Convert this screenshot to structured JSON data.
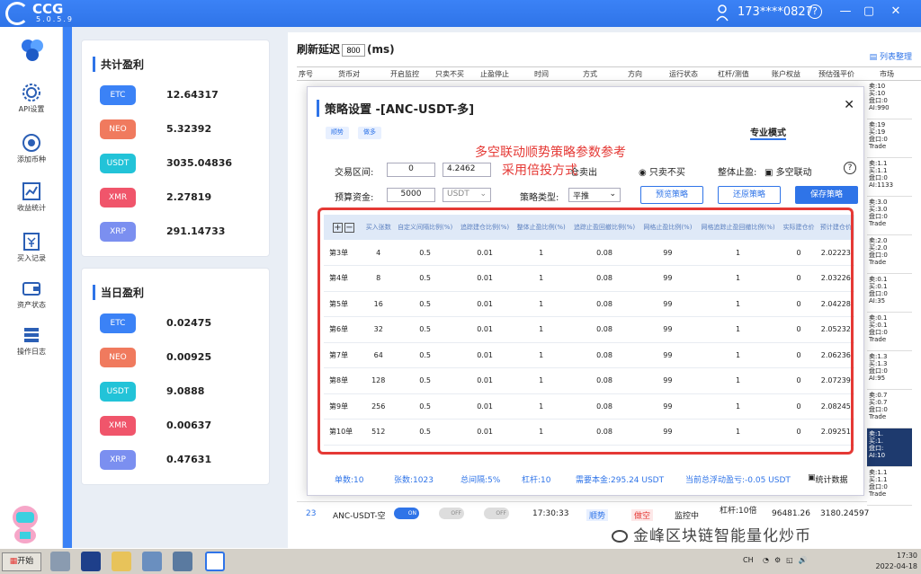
{
  "app": {
    "name": "CCG",
    "version": "5.0.5.9",
    "user": "173****0827",
    "controls": {
      "help": "?",
      "minimize": "—",
      "maximize": "▢",
      "close": "✕"
    }
  },
  "sidebar": {
    "items": [
      {
        "label": "API设置"
      },
      {
        "label": "添加币种"
      },
      {
        "label": "收益统计"
      },
      {
        "label": "买入记录"
      },
      {
        "label": "资产状态"
      },
      {
        "label": "操作日志"
      }
    ]
  },
  "total_profit": {
    "title": "共计盈利",
    "rows": [
      {
        "coin": "ETC",
        "value": "12.64317",
        "color": "#3b82f6"
      },
      {
        "coin": "NEO",
        "value": "5.32392",
        "color": "#f07a5e"
      },
      {
        "coin": "USDT",
        "value": "3035.04836",
        "color": "#22c3d8"
      },
      {
        "coin": "XMR",
        "value": "2.27819",
        "color": "#f0556b"
      },
      {
        "coin": "XRP",
        "value": "291.14733",
        "color": "#7b8ff0"
      }
    ]
  },
  "today_profit": {
    "title": "当日盈利",
    "rows": [
      {
        "coin": "ETC",
        "value": "0.02475",
        "color": "#3b82f6"
      },
      {
        "coin": "NEO",
        "value": "0.00925",
        "color": "#f07a5e"
      },
      {
        "coin": "USDT",
        "value": "9.0888",
        "color": "#22c3d8"
      },
      {
        "coin": "XMR",
        "value": "0.00637",
        "color": "#f0556b"
      },
      {
        "coin": "XRP",
        "value": "0.47631",
        "color": "#7b8ff0"
      }
    ]
  },
  "main": {
    "refresh_label": "刷新延迟",
    "refresh_value": "800",
    "refresh_unit": "(ms)",
    "list_link": "列表整理",
    "columns": [
      "序号",
      "货币对",
      "开启监控",
      "只卖不买",
      "止盈停止",
      "时间",
      "方式",
      "方向",
      "运行状态",
      "杠杆/测值",
      "账户权益",
      "预估强平价",
      "市场"
    ],
    "right_col": [
      "卖:10\n买:10\n盘口:0\nAI:990",
      "卖:19\n买:19\n盘口:0\nTrade",
      "卖:1.1\n买:1.1\n盘口:0\nAI:1133",
      "卖:3.0\n买:3.0\n盘口:0\nTrade",
      "卖:2.0\n买:2.0\n盘口:0\nTrade",
      "卖:0.1\n买:0.1\n盘口:0\nAI:35",
      "卖:0.1\n买:0.1\n盘口:0\nTrade",
      "卖:1.3\n买:1.3\n盘口:0\nAI:95",
      "卖:0.7\n买:0.7\n盘口:0\nTrade",
      "卖:1.\n买:1.\n盘口:\nAI:10",
      "卖:1.1\n买:1.1\n盘口:0\nTrade"
    ],
    "bottom_row": {
      "index": "23",
      "pair": "ANC-USDT-空",
      "toggle_on": "ON",
      "toggle_off1": "OFF",
      "toggle_off2": "OFF",
      "time": "17:30:33",
      "mode": "顺势",
      "direction": "做空",
      "status": "监控中",
      "leverage": "杠杆:10倍",
      "equity": "96481.26",
      "liq": "3180.24597"
    }
  },
  "dialog": {
    "title": "策略设置 -[ANC-USDT-多]",
    "close": "✕",
    "pill1": "顺势",
    "pill2": "做多",
    "pro_mode": "专业模式",
    "overlay1": "多空联动顺势策略参数参考",
    "overlay2": "采用倍投方式",
    "range_label": "交易区间:",
    "range_min": "0",
    "range_max": "4.2462",
    "sell_label": "仓卖出",
    "only_sell_label": "只卖不买",
    "stop_label": "整体止盈:",
    "linkage_label": "多空联动",
    "help": "?",
    "budget_label": "预算资金:",
    "budget_value": "5000",
    "currency": "USDT",
    "type_label": "策略类型:",
    "type_value": "平推",
    "btn_preview": "预览策略",
    "btn_restore": "还原策略",
    "btn_save": "保存策略",
    "grid_icons": {
      "add": "+",
      "remove": "−"
    },
    "grid_headers": [
      "买入张数",
      "自定义间隔比例(%)",
      "追踪建仓比例(%)",
      "整体止盈比例(%)",
      "追踪止盈回撤比例(%)",
      "网格止盈比例(%)",
      "网格追踪止盈回撤比例(%)",
      "实际建仓价",
      "预计建仓价"
    ],
    "grid_rows": [
      [
        "第3单",
        "4",
        "0.5",
        "0.01",
        "1",
        "0.08",
        "99",
        "1",
        "0",
        "2.02223"
      ],
      [
        "第4单",
        "8",
        "0.5",
        "0.01",
        "1",
        "0.08",
        "99",
        "1",
        "0",
        "2.03226"
      ],
      [
        "第5单",
        "16",
        "0.5",
        "0.01",
        "1",
        "0.08",
        "99",
        "1",
        "0",
        "2.04228"
      ],
      [
        "第6单",
        "32",
        "0.5",
        "0.01",
        "1",
        "0.08",
        "99",
        "1",
        "0",
        "2.05232"
      ],
      [
        "第7单",
        "64",
        "0.5",
        "0.01",
        "1",
        "0.08",
        "99",
        "1",
        "0",
        "2.06236"
      ],
      [
        "第8单",
        "128",
        "0.5",
        "0.01",
        "1",
        "0.08",
        "99",
        "1",
        "0",
        "2.07239"
      ],
      [
        "第9单",
        "256",
        "0.5",
        "0.01",
        "1",
        "0.08",
        "99",
        "1",
        "0",
        "2.08245"
      ],
      [
        "第10单",
        "512",
        "0.5",
        "0.01",
        "1",
        "0.08",
        "99",
        "1",
        "0",
        "2.09251"
      ]
    ],
    "summary": {
      "orders": "单数:10",
      "contracts": "张数:1023",
      "range": "总间隔:5%",
      "lev": "杠杆:10",
      "margin": "需要本金:295.24 USDT",
      "float": "当前总浮动盈亏:-0.05 USDT",
      "stats": "统计数据"
    }
  },
  "taskbar": {
    "start": "开始",
    "lang": "CH",
    "time": "17:30",
    "date": "2022-04-18"
  },
  "watermark": "金峰区块链智能量化炒币"
}
